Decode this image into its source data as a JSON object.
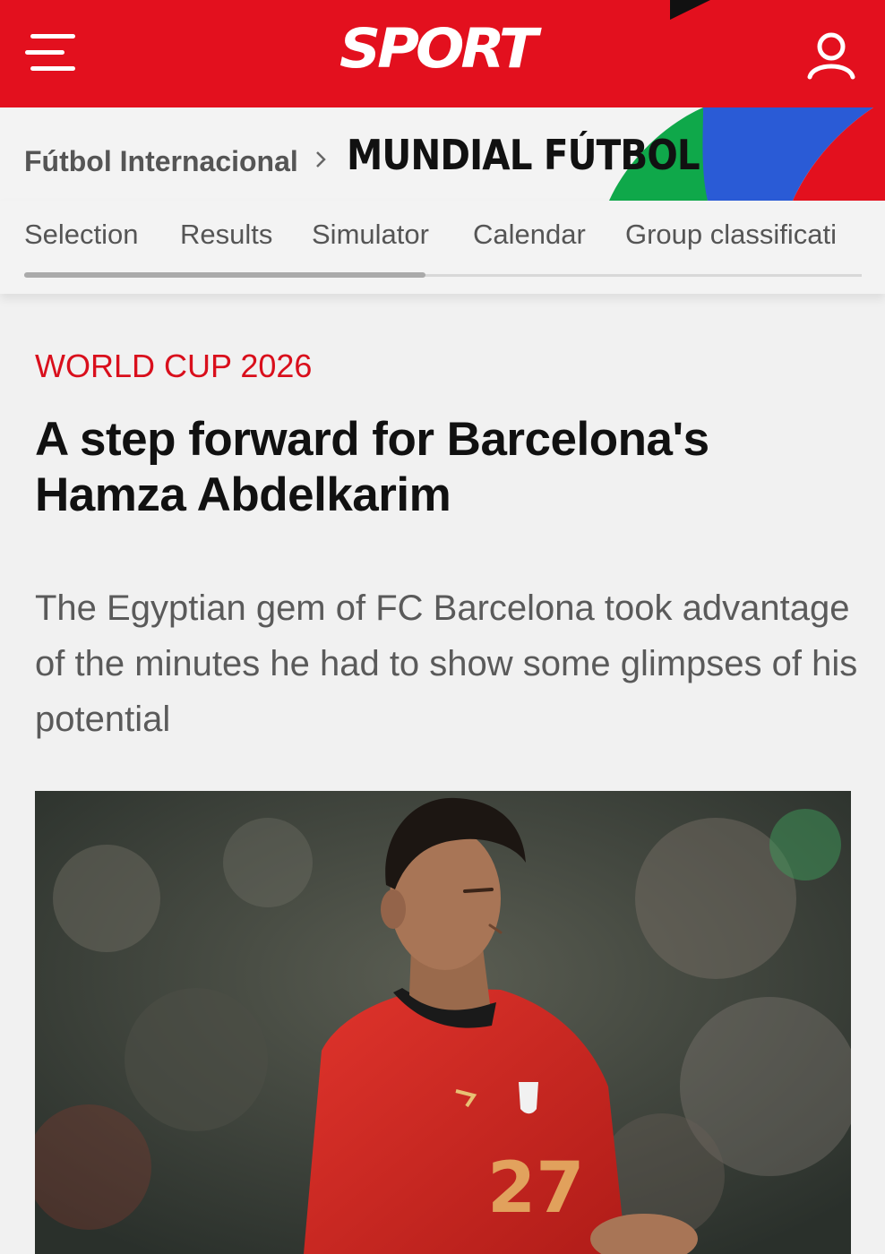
{
  "header": {
    "logo_text": "SPORT",
    "menu_icon": "hamburger-menu-icon",
    "user_icon": "user-account-icon",
    "brand_color": "#e3101e"
  },
  "breadcrumb": {
    "parent": "Fútbol Internacional",
    "separator_icon": "chevron-right-icon",
    "current": "MUNDIAL FÚTBOL"
  },
  "tabs": [
    {
      "label": "Selection"
    },
    {
      "label": "Results"
    },
    {
      "label": "Simulator"
    },
    {
      "label": "Calendar"
    },
    {
      "label": "Group classificati"
    }
  ],
  "article": {
    "kicker": "WORLD CUP 2026",
    "headline": "A step forward for Barcelona's Hamza Abdelkarim",
    "dek": "The Egyptian gem of FC Barcelona took advantage of the minutes he had to show some glimpses of his potential",
    "kicker_color": "#d90f1c",
    "photo_jersey_number": "27"
  }
}
